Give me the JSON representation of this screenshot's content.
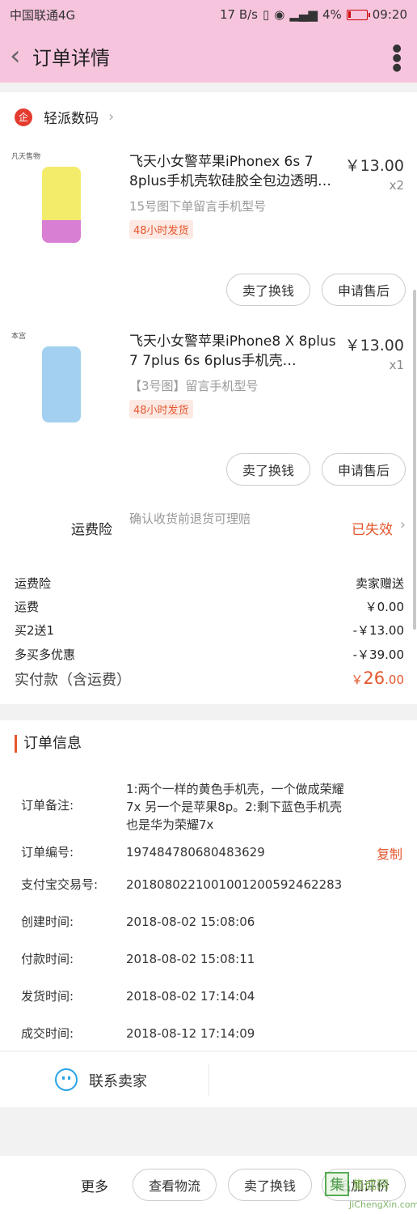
{
  "status": {
    "carrier": "中国联通4G",
    "speed": "17 B/s",
    "battery": "4%",
    "time": "09:20"
  },
  "nav": {
    "title": "订单详情"
  },
  "shop": {
    "badge": "企",
    "name": "轻派数码"
  },
  "items": [
    {
      "title": "飞天小女警苹果iPhonex 6s 7 8plus手机壳软硅胶全包边透明…",
      "price": "￥13.00",
      "qty": "x2",
      "sku": "15号图下单留言手机型号",
      "tag": "48小时发货",
      "thumb_tag": "凡天售物"
    },
    {
      "title": "飞天小女警苹果iPhone8 X 8plus 7 7plus 6s 6plus手机壳…",
      "price": "￥13.00",
      "qty": "x1",
      "sku": "【3号图】留言手机型号",
      "tag": "48小时发货",
      "thumb_tag": "本宫"
    }
  ],
  "actions": {
    "sell": "卖了换钱",
    "after_sale": "申请售后"
  },
  "freight_insurance": {
    "label": "运费险",
    "desc": "确认收货前退货可理赔",
    "status": "已失效"
  },
  "summary": [
    {
      "label": "运费险",
      "value": "卖家赠送"
    },
    {
      "label": "运费",
      "value": "￥0.00"
    },
    {
      "label": "买2送1",
      "value": "-￥13.00"
    },
    {
      "label": "多买多优惠",
      "value": "-￥39.00"
    }
  ],
  "total": {
    "label": "实付款（含运费）",
    "currency": "￥",
    "amount": "26",
    "cents": ".00"
  },
  "order_info": {
    "title": "订单信息",
    "rows": [
      {
        "label": "订单备注:",
        "value": "1:两个一样的黄色手机壳，一个做成荣耀7x 另一个是苹果8p。2:剩下蓝色手机壳也是华为荣耀7x"
      },
      {
        "label": "订单编号:",
        "value": "197484780680483629",
        "action": "复制"
      },
      {
        "label": "支付宝交易号:",
        "value": "2018080221001001200592462283"
      },
      {
        "label": "创建时间:",
        "value": "2018-08-02 15:08:06"
      },
      {
        "label": "付款时间:",
        "value": "2018-08-02 15:08:11"
      },
      {
        "label": "发货时间:",
        "value": "2018-08-02 17:14:04"
      },
      {
        "label": "成交时间:",
        "value": "2018-08-12 17:14:09"
      }
    ]
  },
  "contact": {
    "label": "联系卖家"
  },
  "bottom_bar": {
    "more": "更多",
    "logistics": "查看物流",
    "sell": "卖了换钱",
    "review": "追加评价"
  },
  "watermark": {
    "char": "集",
    "text": "集成网",
    "site": "JiChengXin.com"
  }
}
